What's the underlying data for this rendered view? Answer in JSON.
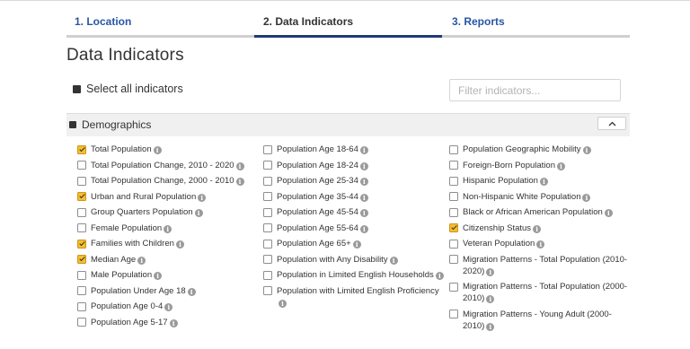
{
  "steps": [
    {
      "label": "1. Location",
      "state": "complete"
    },
    {
      "label": "2. Data Indicators",
      "state": "active"
    },
    {
      "label": "3. Reports",
      "state": "upcoming"
    }
  ],
  "page_title": "Data Indicators",
  "select_all_label": "Select all indicators",
  "filter_placeholder": "Filter indicators...",
  "section": {
    "title": "Demographics",
    "collapse_icon": "chevron-up-icon"
  },
  "columns": [
    [
      {
        "label": "Total Population",
        "checked": true
      },
      {
        "label": "Total Population Change, 2010 - 2020",
        "checked": false
      },
      {
        "label": "Total Population Change, 2000 - 2010",
        "checked": false
      },
      {
        "label": "Urban and Rural Population",
        "checked": true
      },
      {
        "label": "Group Quarters Population",
        "checked": false
      },
      {
        "label": "Female Population",
        "checked": false
      },
      {
        "label": "Families with Children",
        "checked": true
      },
      {
        "label": "Median Age",
        "checked": true
      },
      {
        "label": "Male Population",
        "checked": false
      },
      {
        "label": "Population Under Age 18",
        "checked": false
      },
      {
        "label": "Population Age 0-4",
        "checked": false
      },
      {
        "label": "Population Age 5-17",
        "checked": false
      }
    ],
    [
      {
        "label": "Population Age 18-64",
        "checked": false
      },
      {
        "label": "Population Age 18-24",
        "checked": false
      },
      {
        "label": "Population Age 25-34",
        "checked": false
      },
      {
        "label": "Population Age 35-44",
        "checked": false
      },
      {
        "label": "Population Age 45-54",
        "checked": false
      },
      {
        "label": "Population Age 55-64",
        "checked": false
      },
      {
        "label": "Population Age 65+",
        "checked": false
      },
      {
        "label": "Population with Any Disability",
        "checked": false
      },
      {
        "label": "Population in Limited English Households",
        "checked": false
      },
      {
        "label": "Population with Limited English Proficiency",
        "checked": false
      }
    ],
    [
      {
        "label": "Population Geographic Mobility",
        "checked": false
      },
      {
        "label": "Foreign-Born Population",
        "checked": false
      },
      {
        "label": "Hispanic Population",
        "checked": false
      },
      {
        "label": "Non-Hispanic White Population",
        "checked": false
      },
      {
        "label": "Black or African American Population",
        "checked": false
      },
      {
        "label": "Citizenship Status",
        "checked": true
      },
      {
        "label": "Veteran Population",
        "checked": false
      },
      {
        "label": "Migration Patterns - Total Population (2010-2020)",
        "checked": false
      },
      {
        "label": "Migration Patterns - Total Population (2000-2010)",
        "checked": false
      },
      {
        "label": "Migration Patterns - Young Adult (2000-2010)",
        "checked": false
      }
    ]
  ],
  "info_glyph": "i",
  "colors": {
    "link_blue": "#2a55a4",
    "active_bar": "#1f3a7a",
    "checkbox_checked": "#f6be2c",
    "section_bg": "#f0f0f0"
  }
}
